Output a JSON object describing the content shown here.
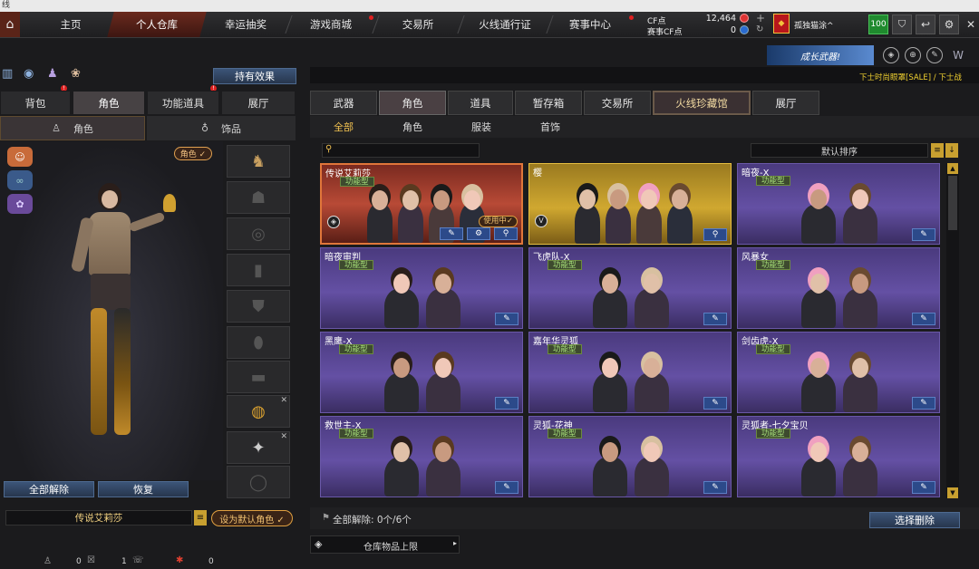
{
  "titlebar": {
    "text": "线"
  },
  "nav": {
    "tabs": [
      "主页",
      "个人仓库",
      "幸运抽奖",
      "游戏商城",
      "交易所",
      "火线通行证",
      "赛事中心"
    ],
    "selected": "个人仓库",
    "cf_label": "CF点",
    "cf_value": "12,464",
    "match_label": "赛事CF点",
    "match_value": "0",
    "player_name": "孤独猫涂^",
    "level": "100"
  },
  "banner": {
    "text": "成长武器!",
    "ticker": "下士时尚眼罩[SALE] / 下士战"
  },
  "left": {
    "effects_button": "持有效果",
    "tabs": [
      "背包",
      "角色",
      "功能道具",
      "展厅"
    ],
    "selected_tab": "角色",
    "sub_tabs": [
      "角色",
      "饰品"
    ],
    "role_tag": "角色 ✓",
    "unequip_all": "全部解除",
    "restore": "恢复",
    "current_name": "传说艾莉莎",
    "set_default": "设为默认角色 ✓"
  },
  "right": {
    "tabs": [
      "武器",
      "角色",
      "道具",
      "暂存箱",
      "交易所",
      "火线珍藏馆",
      "展厅"
    ],
    "selected_tab": "火线珍藏馆",
    "filters": [
      "全部",
      "角色",
      "服装",
      "首饰"
    ],
    "selected_filter": "全部",
    "search_placeholder": "",
    "sort": "默认排序",
    "cards": [
      {
        "name": "传说艾莉莎",
        "badge": "功能型",
        "status": "使用中✓",
        "style": "red"
      },
      {
        "name": "樱",
        "badge": "",
        "status": "",
        "style": "gold"
      },
      {
        "name": "暗夜-X",
        "badge": "功能型",
        "status": "",
        "style": "purple"
      },
      {
        "name": "暗夜审判",
        "badge": "功能型",
        "status": "",
        "style": "purple"
      },
      {
        "name": "飞虎队-X",
        "badge": "功能型",
        "status": "",
        "style": "purple"
      },
      {
        "name": "风暴女",
        "badge": "功能型",
        "status": "",
        "style": "purple"
      },
      {
        "name": "黑鹰-X",
        "badge": "功能型",
        "status": "",
        "style": "purple"
      },
      {
        "name": "嘉年华灵狐",
        "badge": "功能型",
        "status": "",
        "style": "purple"
      },
      {
        "name": "剑齿虎-X",
        "badge": "功能型",
        "status": "",
        "style": "purple"
      },
      {
        "name": "救世主-X",
        "badge": "功能型",
        "status": "",
        "style": "purple"
      },
      {
        "name": "灵狐-花神",
        "badge": "功能型",
        "status": "",
        "style": "purple"
      },
      {
        "name": "灵狐者-七夕宝贝",
        "badge": "功能型",
        "status": "",
        "style": "purple"
      }
    ],
    "unequip_all_label": "全部解除: 0个/6个",
    "select_delete": "选择删除",
    "storage_limit": "仓库物品上限"
  },
  "bottom": {
    "count1": "0",
    "count2": "1",
    "count3": "0"
  }
}
